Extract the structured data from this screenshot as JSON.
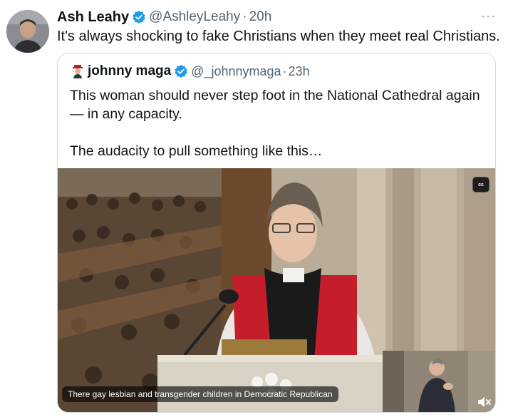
{
  "tweet": {
    "author_name": "Ash Leahy",
    "author_handle": "@AshleyLeahy",
    "separator": "·",
    "time": "20h",
    "more_label": "···",
    "text": "It's always shocking to fake Christians when they meet real Christians."
  },
  "quoted_tweet": {
    "author_name": "johnny maga",
    "author_handle": "@_johnnymaga",
    "separator": "·",
    "time": "23h",
    "text_lines": [
      "This woman should never step foot in the National Cathedral again",
      "— in any capacity.",
      "The audacity to pull something like this…"
    ]
  },
  "video": {
    "cc_label": "cc",
    "caption": "There gay lesbian and transgender children in Democratic Republican"
  },
  "icons": {
    "verified": "verified-badge-icon",
    "more": "more-options-icon",
    "closed_captions": "closed-captions-icon",
    "mute": "speaker-muted-icon",
    "avatar_emoji": "person-emoji-icon"
  },
  "colors": {
    "verified_blue": "#1d9bf0",
    "secondary_text": "#536471",
    "border": "#cfd9de"
  }
}
